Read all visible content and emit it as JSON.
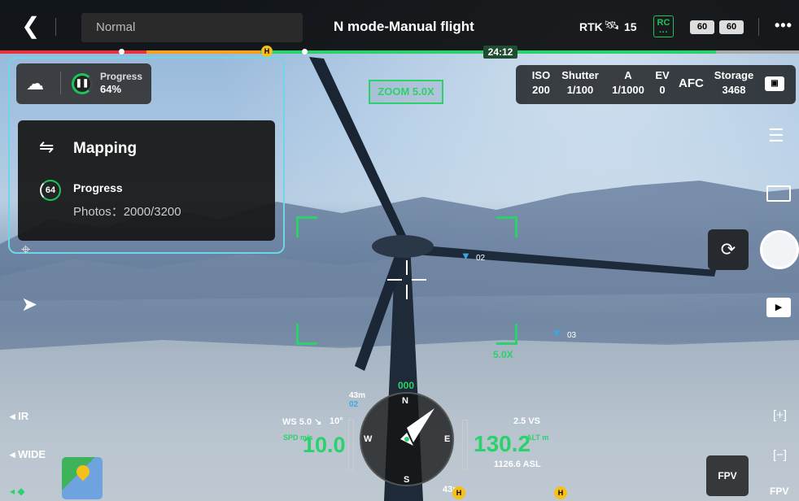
{
  "topbar": {
    "back_icon": "chevron-left-icon",
    "flight_mode": "Normal",
    "title": "N mode-Manual flight",
    "rtk_label": "RTK",
    "satellite_icon": "satellite-icon",
    "satellite_count": "15",
    "rc_label": "RC",
    "battery_1": "60",
    "battery_2": "60",
    "more_icon": "more-icon"
  },
  "timeline": {
    "h_marker": "H",
    "time_remaining": "24:12",
    "colors": {
      "red": "#e8333a",
      "yellow": "#f4a21a",
      "green": "#2bd26b"
    }
  },
  "mission": {
    "progress_label": "Progress",
    "progress_value": "64%",
    "panel_title": "Mapping",
    "ring_value": "64",
    "panel_progress_label": "Progress",
    "photos_text": "Photos：2000/3200"
  },
  "camera": {
    "params": [
      {
        "label": "ISO",
        "value": "200"
      },
      {
        "label": "Shutter",
        "value": "1/100"
      },
      {
        "label": "A",
        "value": "1/1000"
      },
      {
        "label": "EV",
        "value": "0"
      }
    ],
    "focus_mode": "AFC",
    "storage_label": "Storage",
    "storage_value": "3468",
    "zoom_badge": "ZOOM 5.0X",
    "zoom_small": "5.0X"
  },
  "waypoints": [
    {
      "label": "02"
    },
    {
      "label": "03"
    }
  ],
  "left": {
    "ir_label": "IR",
    "wide_label": "WIDE"
  },
  "right": {
    "zoom_in": "[+]",
    "zoom_out": "[−]",
    "fpv_button": "FPV",
    "fpv_label": "FPV"
  },
  "flight": {
    "ws": "WS 5.0 ↘",
    "tilt": "10°",
    "spd_label": "SPD m/s",
    "speed": "10.0",
    "altitude": "130.2",
    "alt_label": "ALT m",
    "vs": "2.5 VS",
    "asl": "1126.6 ASL",
    "heading": "000",
    "dist_top": "43m",
    "dist_wp": "02",
    "dist_bottom": "43m",
    "compass_n": "N",
    "compass_e": "E",
    "compass_s": "S",
    "compass_w": "W",
    "home_marker": "H"
  }
}
